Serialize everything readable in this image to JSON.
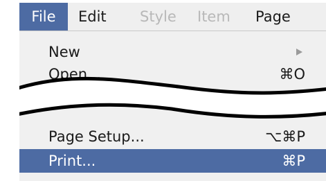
{
  "menubar": {
    "items": [
      {
        "label": "File",
        "state": "selected"
      },
      {
        "label": "Edit",
        "state": "enabled"
      },
      {
        "label": "Style",
        "state": "disabled"
      },
      {
        "label": "Item",
        "state": "disabled"
      },
      {
        "label": "Page",
        "state": "enabled"
      }
    ]
  },
  "file_menu": {
    "new": {
      "label": "New",
      "submenu_icon": "triangle-right-icon"
    },
    "open": {
      "label": "Open...",
      "shortcut": "⌘O"
    },
    "page_setup": {
      "label": "Page Setup...",
      "shortcut": "⌥⌘P"
    },
    "print": {
      "label": "Print...",
      "shortcut": "⌘P"
    }
  },
  "colors": {
    "highlight": "#4d6ba3",
    "menu_background": "#f0f0f0",
    "disabled_text": "#b8b8b8"
  }
}
